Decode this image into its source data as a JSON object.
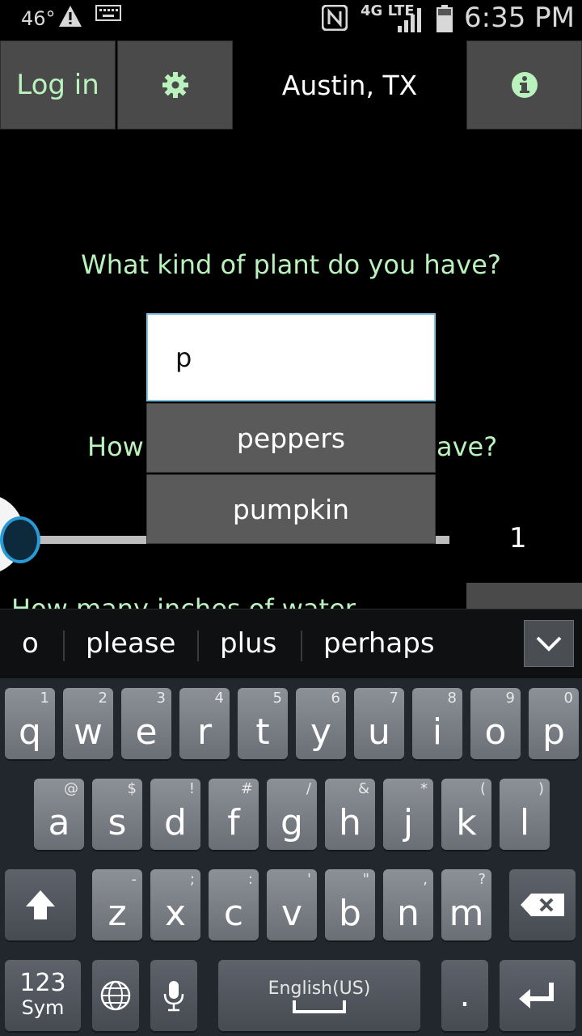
{
  "status_bar": {
    "temperature": "46°",
    "network": "4G LTE",
    "time": "6:35 PM"
  },
  "top_bar": {
    "login_label": "Log in",
    "location": "Austin, TX"
  },
  "form": {
    "question_plant": "What kind of plant do you have?",
    "plant_input_value": "p",
    "suggestions": [
      "peppers",
      "pumpkin"
    ],
    "question_count_left": "How",
    "question_count_right": "ave?",
    "slider_value": "1",
    "question_water": "How many inches of water"
  },
  "keyboard": {
    "word_suggestions": [
      "o",
      "please",
      "plus",
      "perhaps"
    ],
    "row1": [
      {
        "key": "q",
        "alt": "1"
      },
      {
        "key": "w",
        "alt": "2"
      },
      {
        "key": "e",
        "alt": "3"
      },
      {
        "key": "r",
        "alt": "4"
      },
      {
        "key": "t",
        "alt": "5"
      },
      {
        "key": "y",
        "alt": "6"
      },
      {
        "key": "u",
        "alt": "7"
      },
      {
        "key": "i",
        "alt": "8"
      },
      {
        "key": "o",
        "alt": "9"
      },
      {
        "key": "p",
        "alt": "0"
      }
    ],
    "row2": [
      {
        "key": "a",
        "alt": "@"
      },
      {
        "key": "s",
        "alt": "$"
      },
      {
        "key": "d",
        "alt": "!"
      },
      {
        "key": "f",
        "alt": "#"
      },
      {
        "key": "g",
        "alt": "/"
      },
      {
        "key": "h",
        "alt": "&"
      },
      {
        "key": "j",
        "alt": "*"
      },
      {
        "key": "k",
        "alt": "("
      },
      {
        "key": "l",
        "alt": ")"
      }
    ],
    "row3": [
      {
        "key": "z",
        "alt": "-"
      },
      {
        "key": "x",
        "alt": ";"
      },
      {
        "key": "c",
        "alt": ":"
      },
      {
        "key": "v",
        "alt": "'"
      },
      {
        "key": "b",
        "alt": "\""
      },
      {
        "key": "n",
        "alt": ","
      },
      {
        "key": "m",
        "alt": "?"
      }
    ],
    "sym_label_top": "123",
    "sym_label_bottom": "Sym",
    "language_label": "English(US)",
    "period_label": "."
  },
  "colors": {
    "accent_green": "#b9f2bd",
    "slider_blue": "#2a9ad6"
  }
}
